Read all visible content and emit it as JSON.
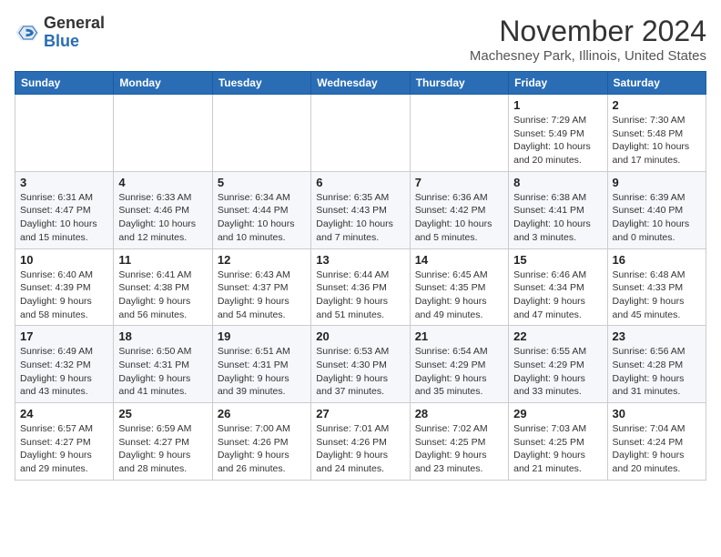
{
  "header": {
    "logo_line1": "General",
    "logo_line2": "Blue",
    "main_title": "November 2024",
    "subtitle": "Machesney Park, Illinois, United States"
  },
  "weekdays": [
    "Sunday",
    "Monday",
    "Tuesday",
    "Wednesday",
    "Thursday",
    "Friday",
    "Saturday"
  ],
  "weeks": [
    [
      {
        "day": "",
        "info": ""
      },
      {
        "day": "",
        "info": ""
      },
      {
        "day": "",
        "info": ""
      },
      {
        "day": "",
        "info": ""
      },
      {
        "day": "",
        "info": ""
      },
      {
        "day": "1",
        "info": "Sunrise: 7:29 AM\nSunset: 5:49 PM\nDaylight: 10 hours\nand 20 minutes."
      },
      {
        "day": "2",
        "info": "Sunrise: 7:30 AM\nSunset: 5:48 PM\nDaylight: 10 hours\nand 17 minutes."
      }
    ],
    [
      {
        "day": "3",
        "info": "Sunrise: 6:31 AM\nSunset: 4:47 PM\nDaylight: 10 hours\nand 15 minutes."
      },
      {
        "day": "4",
        "info": "Sunrise: 6:33 AM\nSunset: 4:46 PM\nDaylight: 10 hours\nand 12 minutes."
      },
      {
        "day": "5",
        "info": "Sunrise: 6:34 AM\nSunset: 4:44 PM\nDaylight: 10 hours\nand 10 minutes."
      },
      {
        "day": "6",
        "info": "Sunrise: 6:35 AM\nSunset: 4:43 PM\nDaylight: 10 hours\nand 7 minutes."
      },
      {
        "day": "7",
        "info": "Sunrise: 6:36 AM\nSunset: 4:42 PM\nDaylight: 10 hours\nand 5 minutes."
      },
      {
        "day": "8",
        "info": "Sunrise: 6:38 AM\nSunset: 4:41 PM\nDaylight: 10 hours\nand 3 minutes."
      },
      {
        "day": "9",
        "info": "Sunrise: 6:39 AM\nSunset: 4:40 PM\nDaylight: 10 hours\nand 0 minutes."
      }
    ],
    [
      {
        "day": "10",
        "info": "Sunrise: 6:40 AM\nSunset: 4:39 PM\nDaylight: 9 hours\nand 58 minutes."
      },
      {
        "day": "11",
        "info": "Sunrise: 6:41 AM\nSunset: 4:38 PM\nDaylight: 9 hours\nand 56 minutes."
      },
      {
        "day": "12",
        "info": "Sunrise: 6:43 AM\nSunset: 4:37 PM\nDaylight: 9 hours\nand 54 minutes."
      },
      {
        "day": "13",
        "info": "Sunrise: 6:44 AM\nSunset: 4:36 PM\nDaylight: 9 hours\nand 51 minutes."
      },
      {
        "day": "14",
        "info": "Sunrise: 6:45 AM\nSunset: 4:35 PM\nDaylight: 9 hours\nand 49 minutes."
      },
      {
        "day": "15",
        "info": "Sunrise: 6:46 AM\nSunset: 4:34 PM\nDaylight: 9 hours\nand 47 minutes."
      },
      {
        "day": "16",
        "info": "Sunrise: 6:48 AM\nSunset: 4:33 PM\nDaylight: 9 hours\nand 45 minutes."
      }
    ],
    [
      {
        "day": "17",
        "info": "Sunrise: 6:49 AM\nSunset: 4:32 PM\nDaylight: 9 hours\nand 43 minutes."
      },
      {
        "day": "18",
        "info": "Sunrise: 6:50 AM\nSunset: 4:31 PM\nDaylight: 9 hours\nand 41 minutes."
      },
      {
        "day": "19",
        "info": "Sunrise: 6:51 AM\nSunset: 4:31 PM\nDaylight: 9 hours\nand 39 minutes."
      },
      {
        "day": "20",
        "info": "Sunrise: 6:53 AM\nSunset: 4:30 PM\nDaylight: 9 hours\nand 37 minutes."
      },
      {
        "day": "21",
        "info": "Sunrise: 6:54 AM\nSunset: 4:29 PM\nDaylight: 9 hours\nand 35 minutes."
      },
      {
        "day": "22",
        "info": "Sunrise: 6:55 AM\nSunset: 4:29 PM\nDaylight: 9 hours\nand 33 minutes."
      },
      {
        "day": "23",
        "info": "Sunrise: 6:56 AM\nSunset: 4:28 PM\nDaylight: 9 hours\nand 31 minutes."
      }
    ],
    [
      {
        "day": "24",
        "info": "Sunrise: 6:57 AM\nSunset: 4:27 PM\nDaylight: 9 hours\nand 29 minutes."
      },
      {
        "day": "25",
        "info": "Sunrise: 6:59 AM\nSunset: 4:27 PM\nDaylight: 9 hours\nand 28 minutes."
      },
      {
        "day": "26",
        "info": "Sunrise: 7:00 AM\nSunset: 4:26 PM\nDaylight: 9 hours\nand 26 minutes."
      },
      {
        "day": "27",
        "info": "Sunrise: 7:01 AM\nSunset: 4:26 PM\nDaylight: 9 hours\nand 24 minutes."
      },
      {
        "day": "28",
        "info": "Sunrise: 7:02 AM\nSunset: 4:25 PM\nDaylight: 9 hours\nand 23 minutes."
      },
      {
        "day": "29",
        "info": "Sunrise: 7:03 AM\nSunset: 4:25 PM\nDaylight: 9 hours\nand 21 minutes."
      },
      {
        "day": "30",
        "info": "Sunrise: 7:04 AM\nSunset: 4:24 PM\nDaylight: 9 hours\nand 20 minutes."
      }
    ]
  ]
}
